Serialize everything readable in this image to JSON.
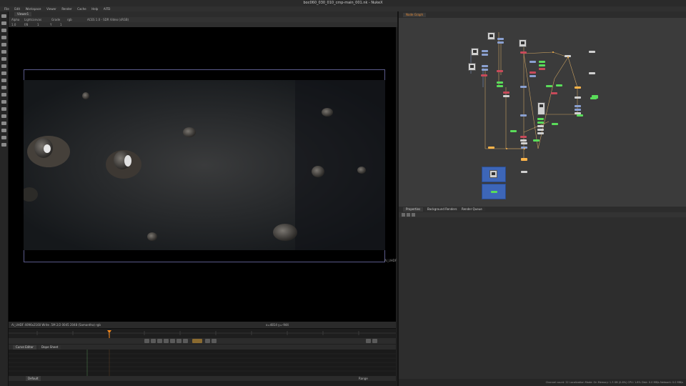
{
  "window": {
    "title": "boc060_030_010_cmp-main_001.nk - NukeX"
  },
  "menu": [
    "File",
    "Edit",
    "Workspace",
    "Viewer",
    "Render",
    "Cache",
    "Help",
    "AITD"
  ],
  "viewer": {
    "tab_label": "Viewer1",
    "controls": [
      "Alpha",
      "Lightcanvas",
      "Grade",
      "rgb",
      "ACES 1.0 - SDR Video (sRGB)"
    ],
    "controls2": [
      "1.0",
      "f/8",
      "1",
      "Y",
      "1"
    ],
    "format_label": "Al_UHDF",
    "status_left": "Al_UHDF 4096x2160  Write   .5M   2/2 0045 2048 (Samantha)  rgb",
    "status_right": "x=4814 y=-944"
  },
  "curve_editor": {
    "tabs": [
      "Curve Editor",
      "Dope Sheet"
    ],
    "bottom_left": "Default",
    "bottom_right": "Range"
  },
  "nodegraph": {
    "tab_label": "Node Graph"
  },
  "properties": {
    "tabs": [
      "Properties",
      "Background Renders",
      "Render Queue"
    ]
  },
  "statusbar": {
    "text": "Channel count: 22  Localization Mode: On  Memory: 1.3 GB (0.8%)  CPU: 1.8%  Disk: 0.0 MB/s  Network: 0.0 MB/s"
  },
  "colors": {
    "accent_orange": "#ffb54a",
    "viewer_bg": "#000000",
    "nodegraph_bg": "#3b3b3b"
  }
}
